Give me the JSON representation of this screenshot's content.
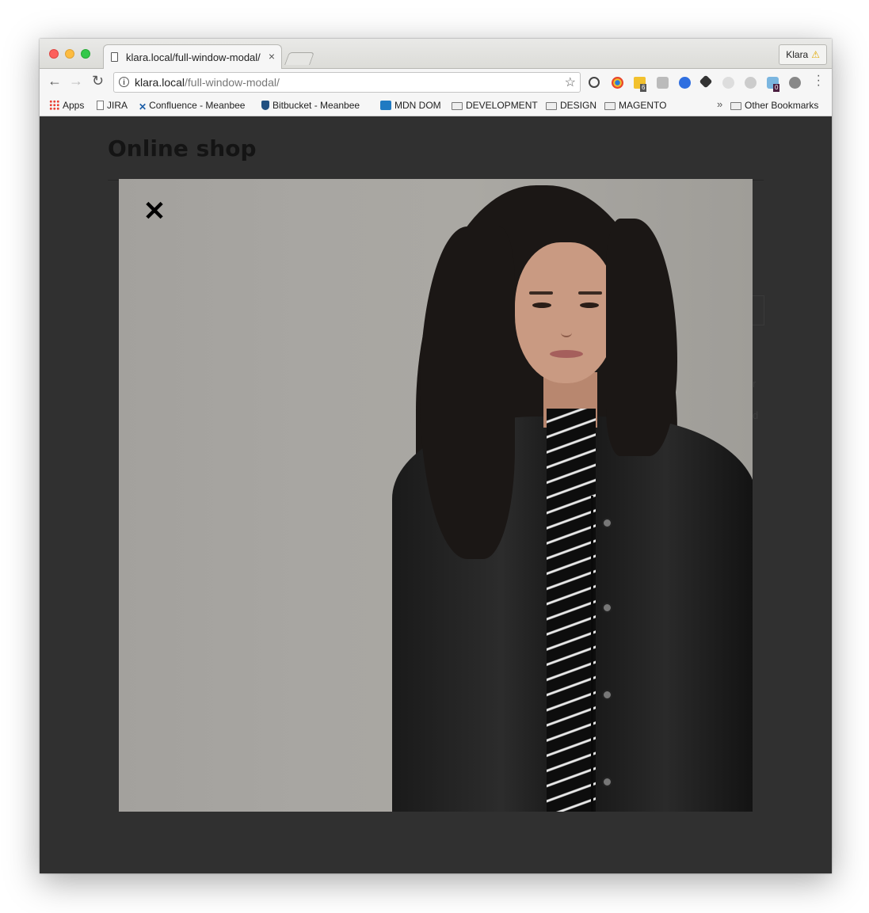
{
  "browser": {
    "tab_title": "klara.local/full-window-modal/",
    "tab_close": "×",
    "profile_name": "Klara",
    "profile_warning": "⚠",
    "url_host": "klara.local",
    "url_path": "/full-window-modal/"
  },
  "nav": {
    "back": "←",
    "forward": "→",
    "reload": "↻",
    "star": "☆",
    "info": "i"
  },
  "bookmarks": {
    "items": [
      {
        "label": "Apps",
        "icon": "apps-grid-icon"
      },
      {
        "label": "JIRA",
        "icon": "page-icon"
      },
      {
        "label": "Confluence - Meanbee",
        "icon": "confluence-icon"
      },
      {
        "label": "Bitbucket - Meanbee",
        "icon": "bitbucket-icon"
      },
      {
        "label": "MDN DOM",
        "icon": "mdn-icon"
      },
      {
        "label": "DEVELOPMENT",
        "icon": "folder-icon"
      },
      {
        "label": "DESIGN",
        "icon": "folder-icon"
      },
      {
        "label": "MAGENTO",
        "icon": "folder-icon"
      }
    ],
    "overflow": "»",
    "other": "Other Bookmarks"
  },
  "extensions": {
    "badge_one": "6",
    "badge_two": "0"
  },
  "page": {
    "title": "Online shop"
  },
  "modal": {
    "close": "✕",
    "image_subject": "woman-in-black-leather-jacket"
  },
  "colors": {
    "overlay": "#303030",
    "modal_background": "#a8a6a2",
    "accent_warning": "#e0a800"
  }
}
